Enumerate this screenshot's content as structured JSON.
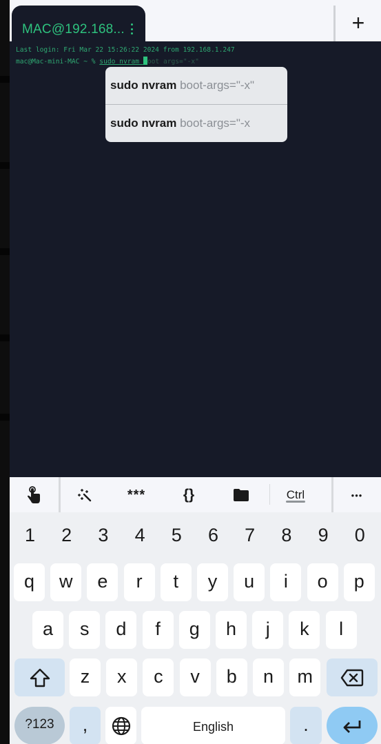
{
  "tab": {
    "title": "MAC@192.168...",
    "menu_icon": "more-vert-icon",
    "new_tab_label": "+"
  },
  "terminal": {
    "line1": "Last login: Fri Mar 22 15:26:22 2024 from 192.168.1.247",
    "prompt": "mac@Mac-mini-MAC ~ % ",
    "typed": "sudo nvram ",
    "ghost": "oot args=\"-x\""
  },
  "suggestions": [
    {
      "bold": "sudo nvram",
      "rest": " boot-args=\"-x\""
    },
    {
      "bold": "sudo nvram",
      "rest": " boot-args=\"-x"
    }
  ],
  "extra_keys": {
    "touch_icon": "touch-hand-icon",
    "magic_icon": "magic-wand-icon",
    "password_label": "***",
    "snippets_label": "{}",
    "folder_icon": "folder-icon",
    "ctrl_label": "Ctrl",
    "more_label": "•••"
  },
  "keyboard": {
    "numbers": [
      "1",
      "2",
      "3",
      "4",
      "5",
      "6",
      "7",
      "8",
      "9",
      "0"
    ],
    "row1": [
      "q",
      "w",
      "e",
      "r",
      "t",
      "y",
      "u",
      "i",
      "o",
      "p"
    ],
    "row2": [
      "a",
      "s",
      "d",
      "f",
      "g",
      "h",
      "j",
      "k",
      "l"
    ],
    "row3": [
      "z",
      "x",
      "c",
      "v",
      "b",
      "n",
      "m"
    ],
    "symbols_label": "?123",
    "comma_label": ",",
    "space_label": "English",
    "period_label": ".",
    "shift_icon": "shift-icon",
    "backspace_icon": "backspace-icon",
    "globe_icon": "globe-icon",
    "enter_icon": "enter-icon"
  }
}
